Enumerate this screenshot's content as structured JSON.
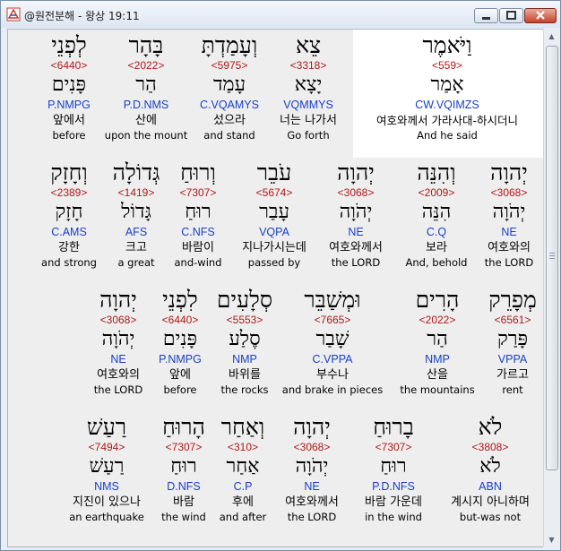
{
  "window": {
    "title": "@원전분해 - 왕상 19:11"
  },
  "rows": [
    {
      "words": [
        {
          "hebrew": "לְפְנֵי",
          "strong": "<6440>",
          "lemma": "פָּנִים",
          "parse": "P.NMPG",
          "korean": "앞에서",
          "english": "before"
        },
        {
          "hebrew": "בָּהָר",
          "strong": "<2022>",
          "lemma": "הַר",
          "parse": "P.D.NMS",
          "korean": "산에",
          "english": "upon the mount"
        },
        {
          "hebrew": "וְעָמַדְתָּ",
          "strong": "<5975>",
          "lemma": "עָמַד",
          "parse": "C.VQAMYS",
          "korean": "섰으라",
          "english": "and stand"
        },
        {
          "hebrew": "צֵא",
          "strong": "<3318>",
          "lemma": "יָצָא",
          "parse": "VQMMYS",
          "korean": "너는 나가서",
          "english": "Go forth"
        },
        {
          "hebrew": "וַיֹּאמֶר",
          "strong": "<559>",
          "lemma": "אָמַר",
          "parse": "CW.VQIMZS",
          "korean": "여호와께서 가라사대-하시더니",
          "english": "And he said"
        }
      ]
    },
    {
      "words": [
        {
          "hebrew": "וְחָזָק",
          "strong": "<2389>",
          "lemma": "חָזָק",
          "parse": "C.AMS",
          "korean": "강한",
          "english": "and strong"
        },
        {
          "hebrew": "גְּדוֹלָה",
          "strong": "<1419>",
          "lemma": "גָּדוֹל",
          "parse": "AFS",
          "korean": "크고",
          "english": "a great"
        },
        {
          "hebrew": "וְרוּחַ",
          "strong": "<7307>",
          "lemma": "רוּחַ",
          "parse": "C.NFS",
          "korean": "바람이",
          "english": "and-wind"
        },
        {
          "hebrew": "עֹבֵר",
          "strong": "<5674>",
          "lemma": "עָבַר",
          "parse": "VQPA",
          "korean": "지나가시는데",
          "english": "passed by"
        },
        {
          "hebrew": "יְהוָה",
          "strong": "<3068>",
          "lemma": "יְהֹוָה",
          "parse": "NE",
          "korean": "여호와께서",
          "english": "the LORD"
        },
        {
          "hebrew": "וְהִנֵּה",
          "strong": "<2009>",
          "lemma": "הִנֵּה",
          "parse": "C.Q",
          "korean": "보라",
          "english": "And, behold"
        },
        {
          "hebrew": "יְהוָה",
          "strong": "<3068>",
          "lemma": "יְהֹוָה",
          "parse": "NE",
          "korean": "여호와의",
          "english": "the LORD"
        }
      ]
    },
    {
      "words": [
        {
          "hebrew": "יְהוָה",
          "strong": "<3068>",
          "lemma": "יְהֹוָה",
          "parse": "NE",
          "korean": "여호와의",
          "english": "the LORD"
        },
        {
          "hebrew": "לִפְנֵי",
          "strong": "<6440>",
          "lemma": "פָּנִים",
          "parse": "P.NMPG",
          "korean": "앞에",
          "english": "before"
        },
        {
          "hebrew": "סְלָעִים",
          "strong": "<5553>",
          "lemma": "סֶלַע",
          "parse": "NMP",
          "korean": "바위를",
          "english": "the rocks"
        },
        {
          "hebrew": "וּמְשַׁבֵּר",
          "strong": "<7665>",
          "lemma": "שָׁבַר",
          "parse": "C.VPPA",
          "korean": "부수나",
          "english": "and brake in pieces"
        },
        {
          "hebrew": "הָרִים",
          "strong": "<2022>",
          "lemma": "הַר",
          "parse": "NMP",
          "korean": "산을",
          "english": "the mountains"
        },
        {
          "hebrew": "מְפָרֵק",
          "strong": "<6561>",
          "lemma": "פָּרַק",
          "parse": "VPPA",
          "korean": "가르고",
          "english": "rent"
        }
      ]
    },
    {
      "words": [
        {
          "hebrew": "רַעַשׁ",
          "strong": "<7494>",
          "lemma": "רַעַשׁ",
          "parse": "NMS",
          "korean": "지진이 있으나",
          "english": "an earthquake"
        },
        {
          "hebrew": "הָרוּחַ",
          "strong": "<7307>",
          "lemma": "רוּחַ",
          "parse": "D.NFS",
          "korean": "바람",
          "english": "the wind"
        },
        {
          "hebrew": "וְאַחַר",
          "strong": "<310>",
          "lemma": "אַחַר",
          "parse": "C.P",
          "korean": "후에",
          "english": "and after"
        },
        {
          "hebrew": "יְהוָה",
          "strong": "<3068>",
          "lemma": "יְהֹוָה",
          "parse": "NE",
          "korean": "여호와께서",
          "english": "the LORD"
        },
        {
          "hebrew": "בָרוּחַ",
          "strong": "<7307>",
          "lemma": "רוּחַ",
          "parse": "P.D.NFS",
          "korean": "바람 가운데",
          "english": "in the wind"
        },
        {
          "hebrew": "לֹא",
          "strong": "<3808>",
          "lemma": "לֹא",
          "parse": "ABN",
          "korean": "계시지 아니하며",
          "english": "but-was not"
        }
      ]
    }
  ]
}
